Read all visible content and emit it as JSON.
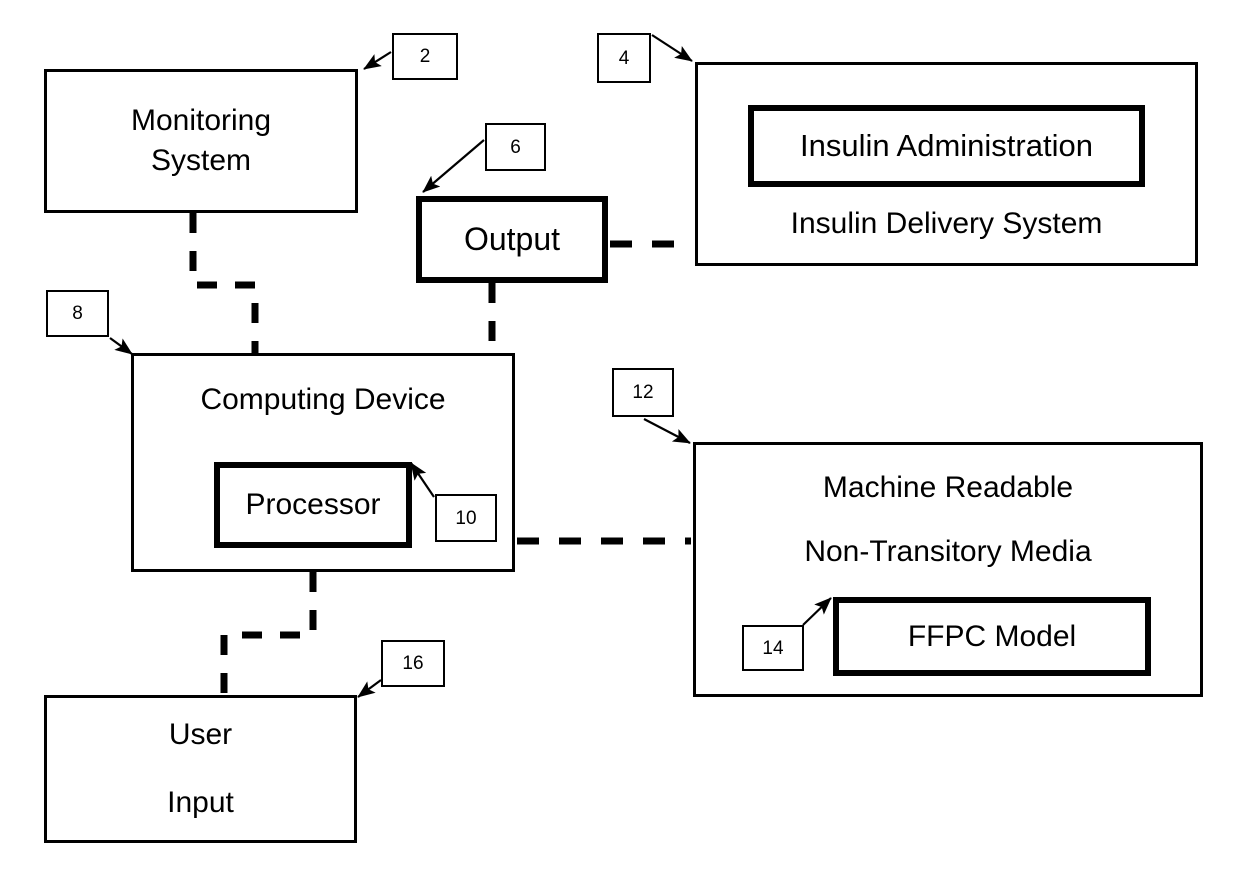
{
  "figure": {
    "type": "patent-block-diagram",
    "background_color": "#ffffff",
    "line_color": "#000000"
  },
  "blocks": {
    "monitoring_system": {
      "lines": [
        "Monitoring",
        "System"
      ],
      "reference_numeral": "2",
      "border": "thin"
    },
    "insulin_delivery_system": {
      "label": "Insulin Delivery System",
      "reference_numeral": "4",
      "border": "thin"
    },
    "insulin_administration": {
      "label": "Insulin Administration",
      "border": "thick"
    },
    "output": {
      "label": "Output",
      "reference_numeral": "6",
      "border": "thick"
    },
    "computing_device": {
      "label": "Computing Device",
      "reference_numeral": "8",
      "border": "thin"
    },
    "processor": {
      "label": "Processor",
      "reference_numeral": "10",
      "border": "thick"
    },
    "machine_readable_media": {
      "lines": [
        "Machine Readable",
        "Non-Transitory Media"
      ],
      "reference_numeral": "12",
      "border": "thin"
    },
    "ffpc_model": {
      "label": "FFPC Model",
      "reference_numeral": "14",
      "border": "thick"
    },
    "user_input": {
      "lines": [
        "User",
        "Input"
      ],
      "reference_numeral": "16",
      "border": "thin"
    }
  },
  "connections": [
    {
      "from": "monitoring_system",
      "to": "computing_device",
      "style": "dashed"
    },
    {
      "from": "output",
      "to": "insulin_delivery_system",
      "style": "dashed"
    },
    {
      "from": "output",
      "to": "computing_device",
      "style": "dashed"
    },
    {
      "from": "computing_device",
      "to": "machine_readable_media",
      "style": "dashed"
    },
    {
      "from": "computing_device",
      "to": "user_input",
      "style": "dashed"
    }
  ]
}
